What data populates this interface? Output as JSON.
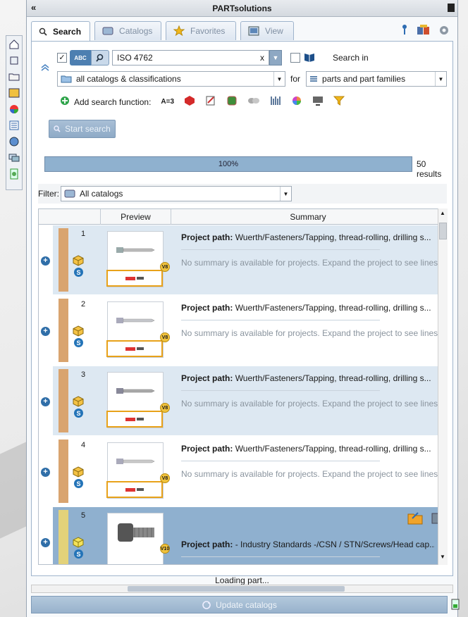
{
  "window": {
    "title": "PARTsolutions",
    "collapse_glyph": "«"
  },
  "tabs": [
    {
      "label": "Search",
      "icon": "search-icon"
    },
    {
      "label": "Catalogs",
      "icon": "catalogs-icon"
    },
    {
      "label": "Favorites",
      "icon": "star-icon"
    },
    {
      "label": "View",
      "icon": "view-icon"
    }
  ],
  "search": {
    "abc_label": "ABC",
    "query": "ISO 4762",
    "clear": "x",
    "search_in_label": "Search in",
    "catalog_scope": "all catalogs & classifications",
    "for_label": "for",
    "target": "parts and part families",
    "add_function_label": "Add search function:",
    "start_button": "Start search"
  },
  "progress": {
    "value": 1.0,
    "label": "100%",
    "results": "50 results"
  },
  "filter": {
    "label": "Filter:",
    "value": "All catalogs"
  },
  "grid": {
    "columns": [
      "Preview",
      "Summary"
    ],
    "rows": [
      {
        "num": "1",
        "version": "V8",
        "path_label": "Project path:",
        "path": "Wuerth/Fasteners/Tapping, thread-rolling, drilling s...",
        "summary": "No summary is available for projects. Expand the project to see lines"
      },
      {
        "num": "2",
        "version": "V8",
        "path_label": "Project path:",
        "path": "Wuerth/Fasteners/Tapping, thread-rolling, drilling s...",
        "summary": "No summary is available for projects. Expand the project to see lines"
      },
      {
        "num": "3",
        "version": "V8",
        "path_label": "Project path:",
        "path": "Wuerth/Fasteners/Tapping, thread-rolling, drilling s...",
        "summary": "No summary is available for projects. Expand the project to see lines"
      },
      {
        "num": "4",
        "version": "V8",
        "path_label": "Project path:",
        "path": "Wuerth/Fasteners/Tapping, thread-rolling, drilling s...",
        "summary": "No summary is available for projects. Expand the project to see lines"
      },
      {
        "num": "5",
        "version": "V10",
        "path_label": "Project path:",
        "path": "- Industry Standards -/CSN / STN/Screws/Head cap...",
        "summary": ""
      }
    ]
  },
  "status": {
    "loading": "Loading part..."
  },
  "update_button": "Update catalogs",
  "colors": {
    "accent": "#4d7fb1",
    "progress": "#8fb1cf",
    "row_even": "#dde8f2",
    "selected": "#8fb0cf"
  }
}
